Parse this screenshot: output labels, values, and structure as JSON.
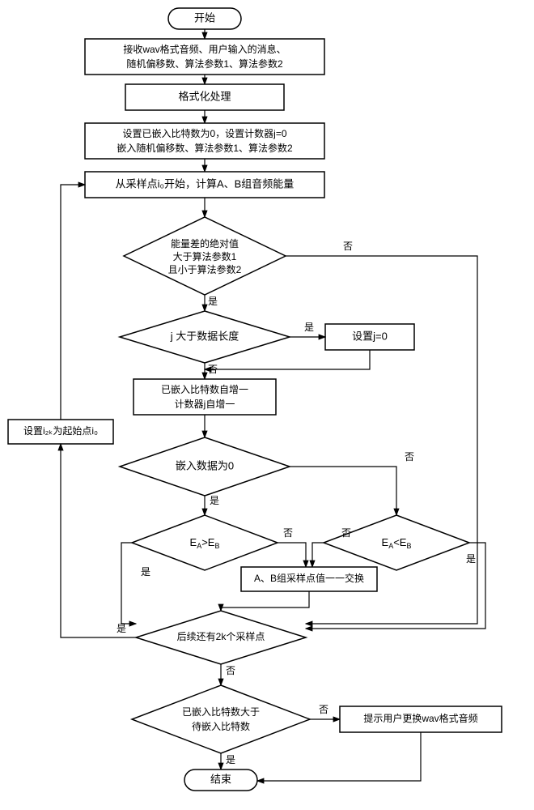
{
  "flow": {
    "start": "开始",
    "end": "结束",
    "recv": {
      "l1": "接收wav格式音频、用户输入的消息、",
      "l2": "随机偏移数、算法参数1、算法参数2"
    },
    "format": "格式化处理",
    "init": {
      "l1": "设置已嵌入比特数为0，设置计数器j=0",
      "l2": "嵌入随机偏移数、算法参数1、算法参数2"
    },
    "calcAB": "从采样点i₀开始，计算A、B组音频能量",
    "energyDiff": {
      "l1": "能量差的绝对值",
      "l2": "大于算法参数1",
      "l3": "且小于算法参数2"
    },
    "jGT": "j 大于数据长度",
    "setJ0": "设置j=0",
    "incr": {
      "l1": "已嵌入比特数自增一",
      "l2": "计数器j自增一"
    },
    "embed0": "嵌入数据为0",
    "eaGTeb": "E",
    "eaGTeb_sub": "A",
    "eaGTeb_gt": ">E",
    "eaGTeb_sub2": "B",
    "eaLTeb": "E",
    "eaLTeb_sub": "A",
    "eaLTeb_lt": "<E",
    "eaLTeb_sub2": "B",
    "swap": "A、B组采样点值一一交换",
    "has2k": "后续还有2k个采样点",
    "setI2k": "设置i₂ₖ为起始点i₀",
    "embedDone": {
      "l1": "已嵌入比特数大于",
      "l2": "待嵌入比特数"
    },
    "prompt": "提示用户更换wav格式音频",
    "yes": "是",
    "no": "否"
  }
}
